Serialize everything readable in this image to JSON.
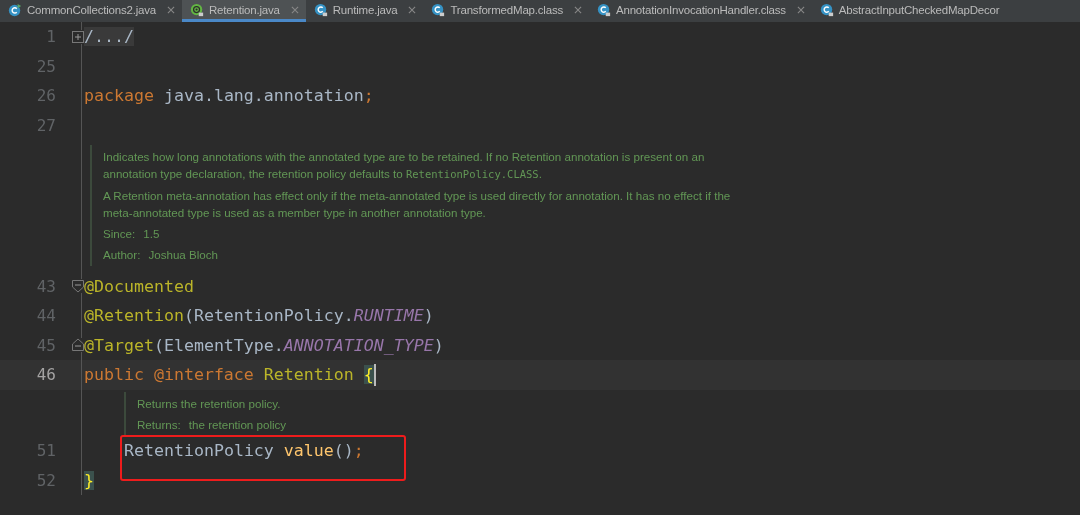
{
  "tabs": [
    {
      "label": "CommonCollections2.java",
      "kind": "runnable-class",
      "selected": false,
      "closable": true
    },
    {
      "label": "Retention.java",
      "kind": "annotation",
      "selected": true,
      "closable": true
    },
    {
      "label": "Runtime.java",
      "kind": "class",
      "selected": false,
      "closable": true
    },
    {
      "label": "TransformedMap.class",
      "kind": "class",
      "selected": false,
      "closable": true
    },
    {
      "label": "AnnotationInvocationHandler.class",
      "kind": "class",
      "selected": false,
      "closable": true
    },
    {
      "label": "AbstractInputCheckedMapDecor",
      "kind": "class",
      "selected": false,
      "closable": false
    }
  ],
  "editor": {
    "lines": [
      {
        "kind": "code",
        "number": "1",
        "fold": {
          "kind": "collapsed"
        },
        "tokens": [
          {
            "text": "/.../",
            "kind": "folded"
          }
        ]
      },
      {
        "kind": "code",
        "number": "25"
      },
      {
        "kind": "code",
        "number": "26",
        "tokens": [
          {
            "text": "package ",
            "kind": "keyword"
          },
          {
            "text": "java.lang.annotation",
            "kind": "plain"
          },
          {
            "text": ";",
            "kind": "keyword"
          }
        ]
      },
      {
        "kind": "code",
        "number": "27"
      },
      {
        "kind": "doc",
        "paragraphs": [
          [
            {
              "text": "Indicates how long annotations with the annotated type are to be retained. If no Retention annotation is present on an annotation type declaration, the retention policy defaults to ",
              "code": false
            },
            {
              "text": "RetentionPolicy.CLASS",
              "code": true
            },
            {
              "text": ".",
              "code": false
            }
          ],
          [
            {
              "text": "A Retention meta-annotation has effect only if the meta-annotated type is used directly for annotation. It has no effect if the meta-annotated type is used as a member type in another annotation type.",
              "code": false
            }
          ]
        ],
        "tags": [
          {
            "label": "Since:",
            "value": "1.5"
          },
          {
            "label": "Author:",
            "value": "Joshua Bloch"
          }
        ]
      },
      {
        "kind": "code",
        "number": "43",
        "fold": {
          "kind": "start"
        },
        "tokens": [
          {
            "text": "@Documented",
            "kind": "annotation"
          }
        ]
      },
      {
        "kind": "code",
        "number": "44",
        "tokens": [
          {
            "text": "@Retention",
            "kind": "annotation"
          },
          {
            "text": "(RetentionPolicy.",
            "kind": "plain"
          },
          {
            "text": "RUNTIME",
            "kind": "constant"
          },
          {
            "text": ")",
            "kind": "plain"
          }
        ]
      },
      {
        "kind": "code",
        "number": "45",
        "fold": {
          "kind": "end"
        },
        "tokens": [
          {
            "text": "@Target",
            "kind": "annotation"
          },
          {
            "text": "(ElementType.",
            "kind": "plain"
          },
          {
            "text": "ANNOTATION_TYPE",
            "kind": "constant"
          },
          {
            "text": ")",
            "kind": "plain"
          }
        ]
      },
      {
        "kind": "code",
        "number": "46",
        "current": true,
        "tokens": [
          {
            "text": "public ",
            "kind": "keyword"
          },
          {
            "text": "@interface ",
            "kind": "keyword"
          },
          {
            "text": "Retention ",
            "kind": "annotation"
          },
          {
            "text": "{",
            "kind": "brace-match"
          }
        ],
        "children": [
          {
            "kind": "doc",
            "paragraphs": [
              [
                {
                  "text": "Returns the retention policy.",
                  "code": false
                }
              ]
            ],
            "tags": [
              {
                "label": "Returns:",
                "value": "the retention policy"
              }
            ]
          },
          {
            "kind": "code",
            "number": "51",
            "highlighted": true,
            "tokens": [
              {
                "text": "RetentionPolicy ",
                "kind": "plain"
              },
              {
                "text": "value",
                "kind": "method"
              },
              {
                "text": "()",
                "kind": "plain"
              },
              {
                "text": ";",
                "kind": "keyword"
              }
            ]
          }
        ]
      },
      {
        "kind": "code",
        "number": "52",
        "tokens": [
          {
            "text": "}",
            "kind": "brace-match"
          }
        ]
      }
    ]
  }
}
